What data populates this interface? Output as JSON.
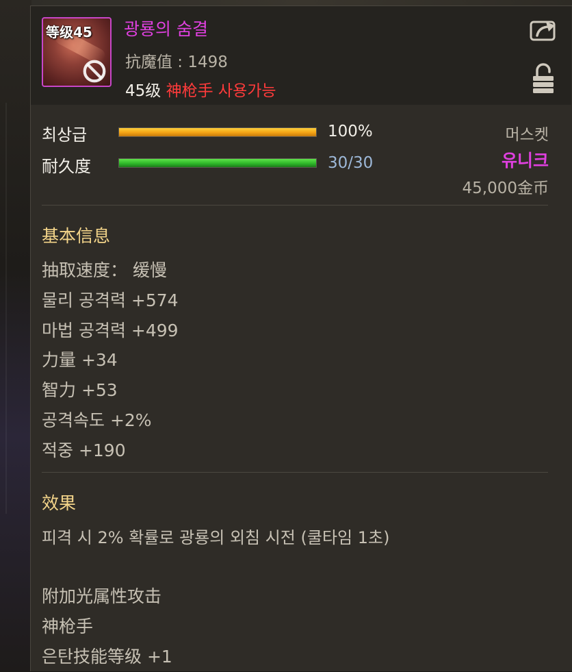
{
  "item": {
    "level_badge": "等级45",
    "name": "광룡의 숨결",
    "magic_resist": "抗魔值 : 1498",
    "required_level": "45级",
    "required_class": "神枪手 사용가능",
    "grade_label": "최상급",
    "grade_value": "100%",
    "grade_fraction": 1.0,
    "durability_label": "耐久度",
    "durability_value": "30/30",
    "durability_fraction": 1.0,
    "weapon_type": "머스켓",
    "rarity": "유니크",
    "price": "45,000金币"
  },
  "basic_info": {
    "title": "基本信息",
    "stats": [
      "抽取速度：  缓慢",
      "물리 공격력 +574",
      "마법 공격력 +499",
      "力量 +34",
      "智力 +53",
      "공격속도 +2%",
      "적중 +190"
    ]
  },
  "effect": {
    "title": "效果",
    "text": "피격 시 2% 확률로 광룡의 외침 시전 (쿨타임 1초)",
    "extras": [
      "附加光属性攻击",
      "神枪手",
      "은탄技能等级 +1"
    ]
  },
  "icons": {
    "share": "share-icon",
    "lock": "lock-icon",
    "forbidden": "no-symbol-icon"
  },
  "colors": {
    "unique": "#e040e0",
    "class_requirement": "#ff3b3b",
    "section_title": "#f4d58a"
  }
}
